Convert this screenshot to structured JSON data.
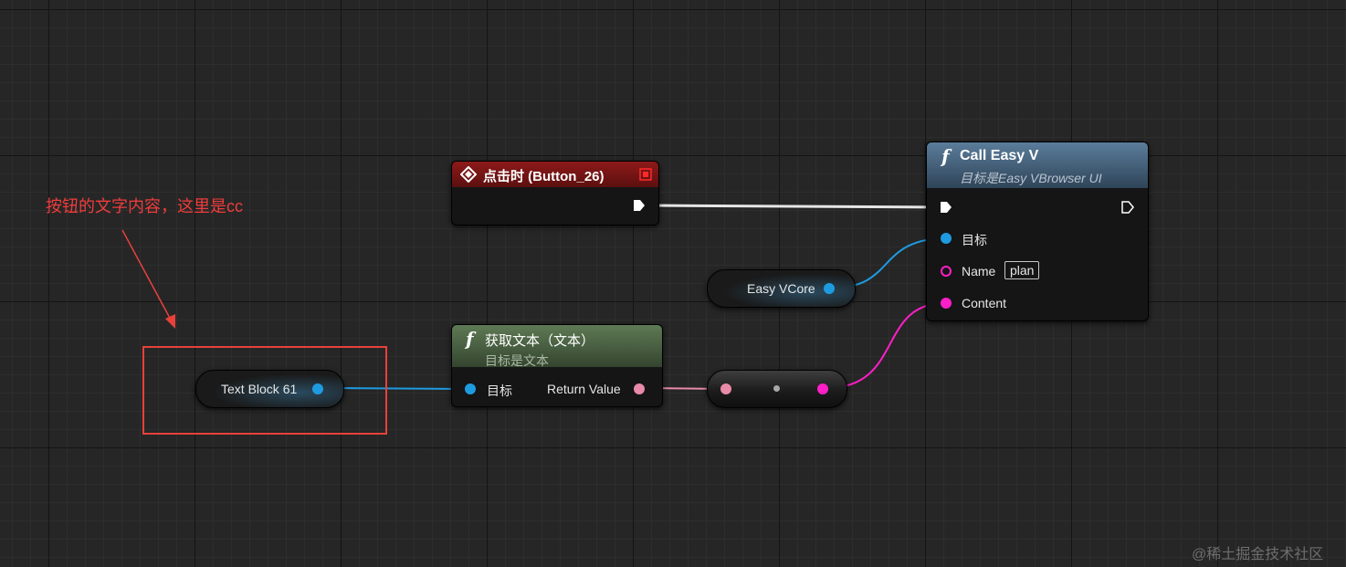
{
  "event_node": {
    "title": "点击时 (Button_26)"
  },
  "call_node": {
    "title": "Call Easy V",
    "subtitle": "目标是Easy VBrowser UI",
    "pins": {
      "target": "目标",
      "name": "Name",
      "name_value": "plan",
      "content": "Content"
    }
  },
  "get_text_node": {
    "title": "获取文本（文本）",
    "subtitle": "目标是文本",
    "pins": {
      "target": "目标",
      "return_value": "Return Value"
    }
  },
  "variables": {
    "easy_vcore": "Easy VCore",
    "text_block": "Text Block 61"
  },
  "annotation": {
    "text": "按钮的文字内容，这里是cc"
  },
  "watermark": "@稀土掘金技术社区",
  "colors": {
    "exec_wire": "#e6e6e6",
    "object_wire": "#1e9be0",
    "text_wire": "#e88aa8",
    "string_wire": "#ff1fc8",
    "annotation": "#e8413c"
  }
}
